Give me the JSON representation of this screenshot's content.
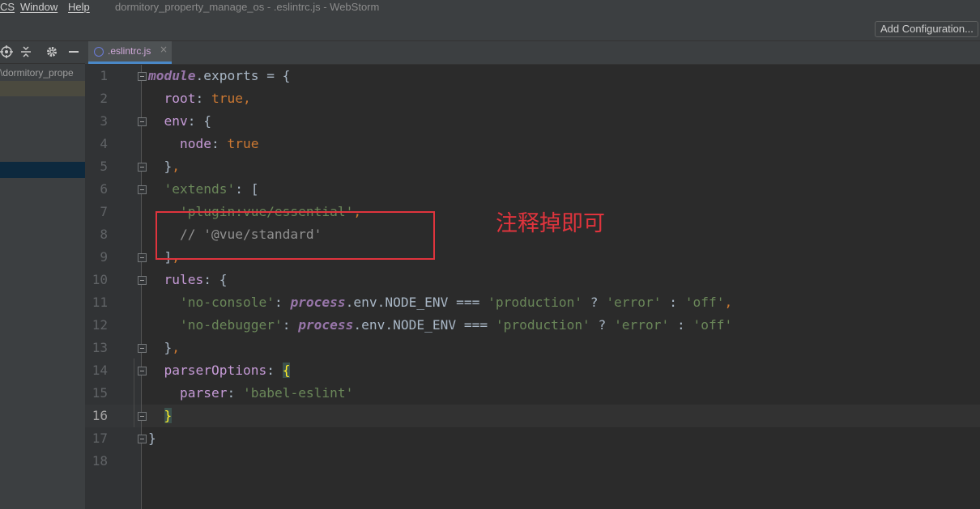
{
  "menu": {
    "items": [
      "CS",
      "Window",
      "Help"
    ]
  },
  "window": {
    "title": "dormitory_property_manage_os - .eslintrc.js - WebStorm"
  },
  "toolbar": {
    "add_configuration_label": "Add Configuration..."
  },
  "project_panel": {
    "icons": [
      "target-icon",
      "collapse-icon",
      "gear-icon",
      "minimize-icon"
    ],
    "path_label": "\\dormitory_prope"
  },
  "editor": {
    "tab": {
      "label": ".eslintrc.js",
      "close": "×"
    },
    "current_line": 16,
    "line_numbers": [
      "1",
      "2",
      "3",
      "4",
      "5",
      "6",
      "7",
      "8",
      "9",
      "10",
      "11",
      "12",
      "13",
      "14",
      "15",
      "16",
      "17",
      "18"
    ],
    "lines": [
      [
        {
          "t": "module",
          "c": "proc"
        },
        {
          "t": ".exports = {",
          "c": "plain"
        }
      ],
      [
        {
          "t": "  root",
          "c": "key"
        },
        {
          "t": ": ",
          "c": "plain"
        },
        {
          "t": "true",
          "c": "kw"
        },
        {
          "t": ",",
          "c": "kw"
        }
      ],
      [
        {
          "t": "  env",
          "c": "key"
        },
        {
          "t": ": {",
          "c": "plain"
        }
      ],
      [
        {
          "t": "    node",
          "c": "key"
        },
        {
          "t": ": ",
          "c": "plain"
        },
        {
          "t": "true",
          "c": "kw"
        }
      ],
      [
        {
          "t": "  }",
          "c": "plain"
        },
        {
          "t": ",",
          "c": "kw"
        }
      ],
      [
        {
          "t": "  'extends'",
          "c": "str"
        },
        {
          "t": ": [",
          "c": "plain"
        }
      ],
      [
        {
          "t": "    'plugin:vue/essential'",
          "c": "str"
        },
        {
          "t": ",",
          "c": "kw"
        }
      ],
      [
        {
          "t": "    // '@vue/standard'",
          "c": "cmt"
        }
      ],
      [
        {
          "t": "  ]",
          "c": "plain"
        },
        {
          "t": ",",
          "c": "kw"
        }
      ],
      [
        {
          "t": "  rules",
          "c": "key"
        },
        {
          "t": ": {",
          "c": "plain"
        }
      ],
      [
        {
          "t": "    'no-console'",
          "c": "str"
        },
        {
          "t": ": ",
          "c": "plain"
        },
        {
          "t": "process",
          "c": "proc"
        },
        {
          "t": ".env.NODE_ENV === ",
          "c": "plain"
        },
        {
          "t": "'production'",
          "c": "str"
        },
        {
          "t": " ? ",
          "c": "plain"
        },
        {
          "t": "'error'",
          "c": "str"
        },
        {
          "t": " : ",
          "c": "plain"
        },
        {
          "t": "'off'",
          "c": "str"
        },
        {
          "t": ",",
          "c": "kw"
        }
      ],
      [
        {
          "t": "    'no-debugger'",
          "c": "str"
        },
        {
          "t": ": ",
          "c": "plain"
        },
        {
          "t": "process",
          "c": "proc"
        },
        {
          "t": ".env.NODE_ENV === ",
          "c": "plain"
        },
        {
          "t": "'production'",
          "c": "str"
        },
        {
          "t": " ? ",
          "c": "plain"
        },
        {
          "t": "'error'",
          "c": "str"
        },
        {
          "t": " : ",
          "c": "plain"
        },
        {
          "t": "'off'",
          "c": "str"
        }
      ],
      [
        {
          "t": "  }",
          "c": "plain"
        },
        {
          "t": ",",
          "c": "kw"
        }
      ],
      [
        {
          "t": "  parserOptions",
          "c": "key"
        },
        {
          "t": ": ",
          "c": "plain"
        },
        {
          "t": "{",
          "c": "brace"
        }
      ],
      [
        {
          "t": "    parser",
          "c": "key"
        },
        {
          "t": ": ",
          "c": "plain"
        },
        {
          "t": "'babel-eslint'",
          "c": "str"
        }
      ],
      [
        {
          "t": "  ",
          "c": "plain"
        },
        {
          "t": "}",
          "c": "brace"
        }
      ],
      [
        {
          "t": "}",
          "c": "plain"
        }
      ],
      []
    ]
  },
  "annotation": {
    "note": "注释掉即可",
    "color": "#e0343d"
  }
}
